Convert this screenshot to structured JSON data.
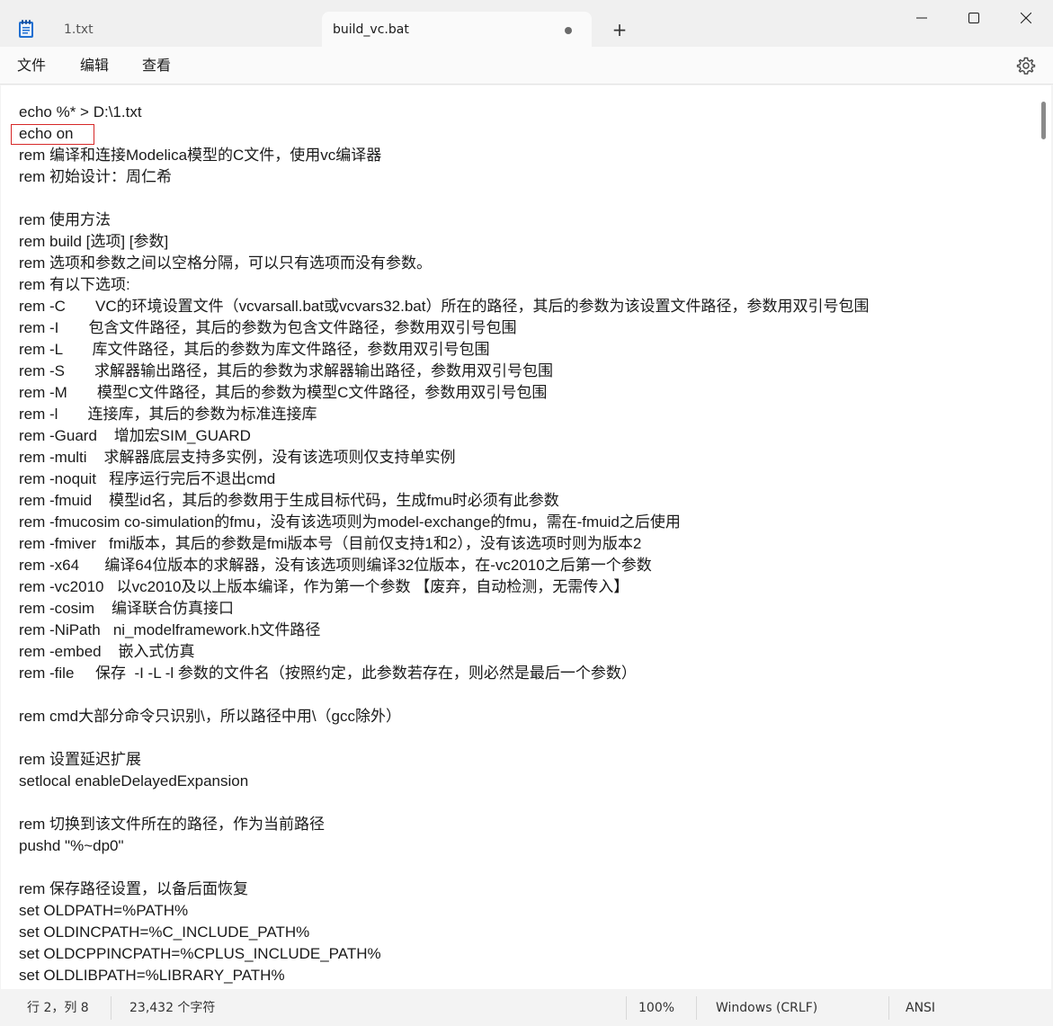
{
  "tabs": [
    {
      "label": "1.txt"
    },
    {
      "label": "build_vc.bat",
      "unsaved": true
    }
  ],
  "new_tab_label": "+",
  "menu": {
    "file": "文件",
    "edit": "编辑",
    "view": "查看"
  },
  "icons": {
    "app": "notepad-icon",
    "settings": "gear-icon",
    "minimize": "minimize-icon",
    "maximize": "maximize-icon",
    "close": "close-icon"
  },
  "editor": {
    "lines": [
      "echo %* > D:\\1.txt",
      "echo on",
      "rem 编译和连接Modelica模型的C文件，使用vc编译器",
      "rem 初始设计：周仁希",
      "",
      "rem 使用方法",
      "rem build [选项] [参数]",
      "rem 选项和参数之间以空格分隔，可以只有选项而没有参数。",
      "rem 有以下选项:",
      "rem -C       VC的环境设置文件（vcvarsall.bat或vcvars32.bat）所在的路径，其后的参数为该设置文件路径，参数用双引号包围",
      "rem -I       包含文件路径，其后的参数为包含文件路径，参数用双引号包围",
      "rem -L       库文件路径，其后的参数为库文件路径，参数用双引号包围",
      "rem -S       求解器输出路径，其后的参数为求解器输出路径，参数用双引号包围",
      "rem -M       模型C文件路径，其后的参数为模型C文件路径，参数用双引号包围",
      "rem -l       连接库，其后的参数为标准连接库",
      "rem -Guard    增加宏SIM_GUARD",
      "rem -multi    求解器底层支持多实例，没有该选项则仅支持单实例",
      "rem -noquit   程序运行完后不退出cmd",
      "rem -fmuid    模型id名，其后的参数用于生成目标代码，生成fmu时必须有此参数",
      "rem -fmucosim co-simulation的fmu，没有该选项则为model-exchange的fmu，需在-fmuid之后使用",
      "rem -fmiver   fmi版本，其后的参数是fmi版本号（目前仅支持1和2），没有该选项时则为版本2",
      "rem -x64      编译64位版本的求解器，没有该选项则编译32位版本，在-vc2010之后第一个参数",
      "rem -vc2010   以vc2010及以上版本编译，作为第一个参数 【废弃，自动检测，无需传入】",
      "rem -cosim    编译联合仿真接口",
      "rem -NiPath   ni_modelframework.h文件路径",
      "rem -embed    嵌入式仿真",
      "rem -file     保存  -I -L -l 参数的文件名（按照约定，此参数若存在，则必然是最后一个参数）",
      "",
      "rem cmd大部分命令只识别\\，所以路径中用\\（gcc除外）",
      "",
      "rem 设置延迟扩展",
      "setlocal enableDelayedExpansion",
      "",
      "rem 切换到该文件所在的路径，作为当前路径",
      "pushd \"%~dp0\"",
      "",
      "rem 保存路径设置，以备后面恢复",
      "set OLDPATH=%PATH%",
      "set OLDINCPATH=%C_INCLUDE_PATH%",
      "set OLDCPPINCPATH=%CPLUS_INCLUDE_PATH%",
      "set OLDLIBPATH=%LIBRARY_PATH%"
    ]
  },
  "status": {
    "position": "行 2，列 8",
    "chars": "23,432 个字符",
    "zoom": "100%",
    "eol": "Windows (CRLF)",
    "encoding": "ANSI"
  }
}
